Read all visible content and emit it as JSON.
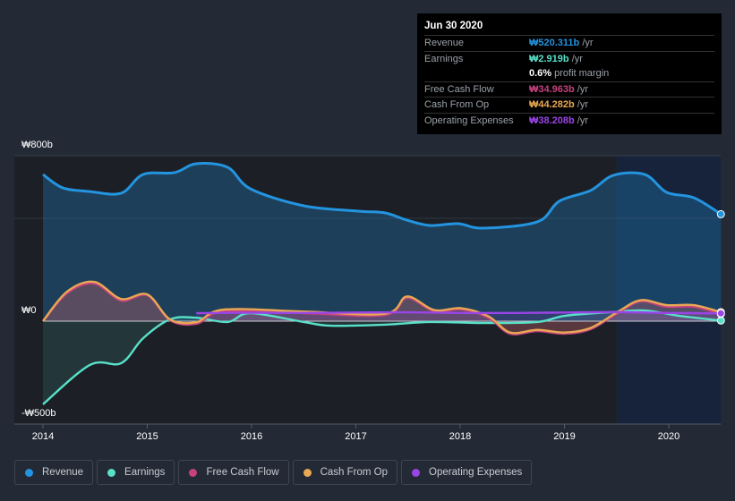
{
  "tooltip": {
    "date": "Jun 30 2020",
    "rows": [
      {
        "label": "Revenue",
        "value": "₩520.311b",
        "unit": " /yr",
        "color": "#2394df"
      },
      {
        "label": "Earnings",
        "value": "₩2.919b",
        "unit": " /yr",
        "color": "#58e1c8"
      },
      {
        "label": "",
        "value": "0.6%",
        "unit": " profit margin",
        "color": "#ffffff"
      },
      {
        "label": "Free Cash Flow",
        "value": "₩34.963b",
        "unit": " /yr",
        "color": "#c5427f"
      },
      {
        "label": "Cash From Op",
        "value": "₩44.282b",
        "unit": " /yr",
        "color": "#e9a853"
      },
      {
        "label": "Operating Expenses",
        "value": "₩38.208b",
        "unit": " /yr",
        "color": "#9a45e6"
      }
    ]
  },
  "chart_data": {
    "type": "line",
    "yticks": [
      "₩800b",
      "₩0",
      "-₩500b"
    ],
    "ylim": [
      -500,
      800
    ],
    "xlim": [
      2013.7,
      2020.5
    ],
    "xticks": [
      "2014",
      "2015",
      "2016",
      "2017",
      "2018",
      "2019",
      "2020"
    ],
    "highlight_from": 2019.5,
    "series": [
      {
        "name": "Revenue",
        "color": "#2394df",
        "x": [
          2014,
          2014.19,
          2014.45,
          2014.75,
          2014.96,
          2015.26,
          2015.47,
          2015.77,
          2015.99,
          2016.5,
          2017.02,
          2017.28,
          2017.49,
          2017.71,
          2017.98,
          2018.22,
          2018.74,
          2018.95,
          2019.25,
          2019.47,
          2019.77,
          2019.98,
          2020.24,
          2020.5
        ],
        "values": [
          713,
          648,
          630,
          622,
          713,
          722,
          765,
          748,
          643,
          561,
          535,
          526,
          491,
          465,
          474,
          452,
          483,
          583,
          635,
          709,
          713,
          626,
          600,
          520
        ]
      },
      {
        "name": "Earnings",
        "color": "#58e1c8",
        "x": [
          2014,
          2014.45,
          2014.75,
          2014.96,
          2015.22,
          2015.47,
          2015.77,
          2015.99,
          2016.5,
          2016.76,
          2017.28,
          2017.71,
          2018.22,
          2018.74,
          2019,
          2019.43,
          2019.77,
          2020.1,
          2020.5
        ],
        "values": [
          -404,
          -213,
          -204,
          -83,
          9,
          17,
          -4,
          39,
          -4,
          -22,
          -17,
          -4,
          -9,
          -4,
          26,
          43,
          52,
          26,
          3
        ]
      },
      {
        "name": "Free Cash Flow",
        "color": "#c5427f",
        "x": [
          2014,
          2014.23,
          2014.49,
          2014.75,
          2015,
          2015.22,
          2015.47,
          2015.73,
          2016.5,
          2017.28,
          2017.49,
          2017.75,
          2018.01,
          2018.27,
          2018.48,
          2018.74,
          2019,
          2019.25,
          2019.51,
          2019.73,
          2019.98,
          2020.24,
          2020.5
        ],
        "values": [
          0,
          135,
          183,
          100,
          126,
          4,
          -13,
          48,
          39,
          30,
          113,
          48,
          57,
          17,
          -61,
          -48,
          -61,
          -39,
          39,
          96,
          70,
          70,
          35
        ]
      },
      {
        "name": "Cash From Op",
        "color": "#e9a853",
        "x": [
          2014,
          2014.23,
          2014.49,
          2014.75,
          2015,
          2015.22,
          2015.47,
          2015.73,
          2016.5,
          2017.28,
          2017.49,
          2017.75,
          2018.01,
          2018.27,
          2018.48,
          2018.74,
          2019,
          2019.25,
          2019.51,
          2019.73,
          2019.98,
          2020.24,
          2020.5
        ],
        "values": [
          0,
          143,
          191,
          108,
          130,
          8,
          -5,
          56,
          47,
          36,
          120,
          54,
          63,
          24,
          -55,
          -42,
          -55,
          -33,
          45,
          102,
          78,
          78,
          44
        ]
      },
      {
        "name": "Operating Expenses",
        "color": "#9a45e6",
        "x": [
          2015.47,
          2016,
          2016.5,
          2017,
          2017.5,
          2018,
          2018.5,
          2019,
          2019.5,
          2020,
          2020.5
        ],
        "values": [
          39,
          41,
          40,
          42,
          43,
          40,
          40,
          42,
          44,
          40,
          38
        ]
      }
    ]
  }
}
